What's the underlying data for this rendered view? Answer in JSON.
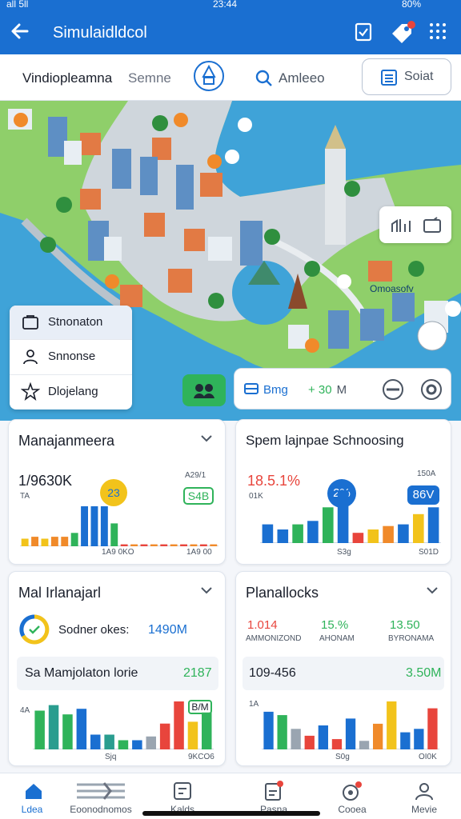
{
  "statusbar": {
    "left": "all 5ll",
    "time": "23:44",
    "battery": "80%"
  },
  "appbar": {
    "title": "Simulaidldcol"
  },
  "tabs": {
    "tab1": "Vindiopleamna",
    "tab2": "Semne",
    "search_label": "Amleeo",
    "button_label": "Soiat"
  },
  "map": {
    "label": "Omoasofv",
    "menu": [
      "Stnonaton",
      "Snnonse",
      "Dlojelang"
    ],
    "info": {
      "left": "Bmg",
      "value": "+ 30",
      "unit": "M"
    }
  },
  "cards": {
    "c1": {
      "title": "Manajanmeera",
      "value": "1/9630K",
      "sub": "TA",
      "badge1": "23",
      "right_top": "A29/1",
      "badge2": "S4B",
      "xlabel": "1A9 0KO",
      "xend": "1A9 00"
    },
    "c2": {
      "title": "Spem lajnpae Schnoosing",
      "value": "18.5.1%",
      "sub": "01K",
      "badge1": "2%",
      "right_top": "150A",
      "badge2": "86V",
      "xlabel": "S3g",
      "xend": "S01D"
    },
    "c3": {
      "title": "Mal Irlanajarl",
      "ring_label": "Sodner okes:",
      "ring_value": "1490M",
      "row_label": "Sa Mamjolaton lorie",
      "row_value": "2187",
      "ytop": "4A",
      "badge": "B/M",
      "xlabel": "Sjq",
      "xend": "9KCO6"
    },
    "c4": {
      "title": "Planallocks",
      "stats": [
        {
          "value": "1.014",
          "label": "AMMONIZOND"
        },
        {
          "value": "15.%",
          "label": "AHONAM"
        },
        {
          "value": "13.50",
          "label": "BYRONAMA"
        }
      ],
      "row_label": "109-456",
      "row_value": "3.50M",
      "ytop": "1A",
      "xlabel": "S0g",
      "xend": "OI0K"
    }
  },
  "chart_data": [
    {
      "type": "bar",
      "title": "Manajanmeera",
      "values": [
        8,
        10,
        8,
        10,
        10,
        14,
        42,
        42,
        42,
        24,
        2,
        2,
        2,
        2,
        2,
        2,
        2,
        2,
        2,
        2
      ]
    },
    {
      "type": "bar",
      "title": "Spem lajnpae Schnoosing",
      "values": [
        22,
        16,
        22,
        26,
        42,
        62,
        12,
        16,
        20,
        22,
        34,
        42
      ]
    },
    {
      "type": "bar",
      "title": "Mal Irlanajarl",
      "values": [
        42,
        48,
        38,
        44,
        16,
        16,
        10,
        10,
        14,
        28,
        52,
        30,
        40
      ]
    },
    {
      "type": "bar",
      "title": "Planallocks",
      "values": [
        44,
        40,
        24,
        16,
        28,
        12,
        36,
        10,
        30,
        56,
        20,
        24,
        48
      ]
    }
  ],
  "nav": [
    "Ldea",
    "Eoonodnomos",
    "Kalds",
    "Pasna",
    "Cooea",
    "Mevie"
  ],
  "colors": {
    "primary": "#1a6fd1",
    "green": "#2fb35a",
    "orange": "#f08a2a",
    "yellow": "#f2c31b",
    "red": "#e8453c"
  }
}
